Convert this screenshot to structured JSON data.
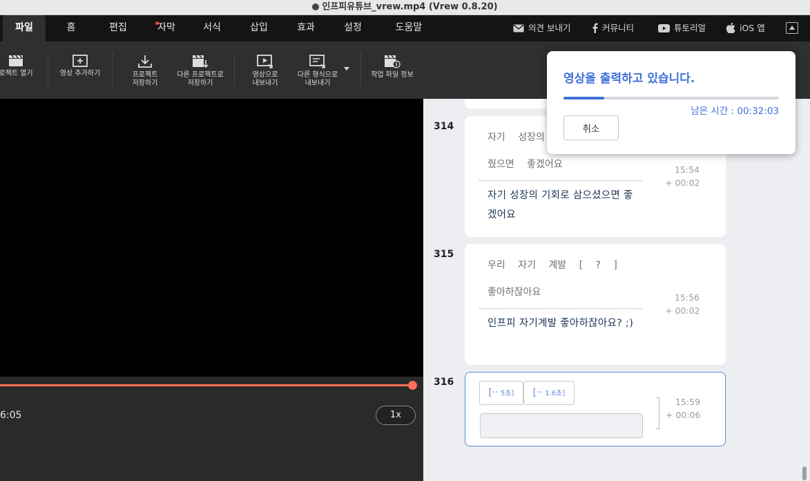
{
  "window": {
    "title": "인프피유튜브_vrew.mp4 (Vrew 0.8.20)"
  },
  "menu": {
    "tabs": [
      {
        "label": "파일"
      },
      {
        "label": "홈"
      },
      {
        "label": "편집"
      },
      {
        "label": "자막"
      },
      {
        "label": "서식"
      },
      {
        "label": "삽입"
      },
      {
        "label": "효과"
      },
      {
        "label": "설정"
      },
      {
        "label": "도움말"
      }
    ],
    "active_tab": "파일",
    "links": {
      "feedback": "의견 보내기",
      "community": "커뮤니티",
      "tutorial": "튜토리얼",
      "ios": "iOS 앱"
    }
  },
  "toolbar": {
    "open_project": "로젝트 열기",
    "add_video": "영상 추가하기",
    "save_project": "프로젝트\n저장하기",
    "save_as": "다른 프로젝트로\n저장하기",
    "export_video": "영상으로\n내보내기",
    "export_other": "다른 형식으로\n내보내기",
    "file_info": "작업 파일 정보"
  },
  "player": {
    "current_time": "6:05",
    "speed": "1x",
    "progress": 1.0
  },
  "clips": [
    {
      "number": "314",
      "words_line1": "자기 성장의",
      "words_line2": "줬으면 좋겠어요",
      "subtitle": "자기 성장의 기회로 삼으셨으면 좋겠어요",
      "time": "15:54",
      "duration": "+ 00:02"
    },
    {
      "number": "315",
      "words_line1": "우리 자기 계발 [ ? ]",
      "words_line2": "좋아하잖아요",
      "subtitle": "인프피 자기계발 좋아하잖아요? ;)",
      "time": "15:56",
      "duration": "+ 00:02"
    },
    {
      "number": "316",
      "silence_chips": [
        {
          "prefix": "[··",
          "value": "5초]"
        },
        {
          "prefix": "[··",
          "value": "1.6초]"
        }
      ],
      "time": "15:59",
      "duration": "+ 00:06"
    }
  ],
  "export_dialog": {
    "title": "영상을 출력하고 있습니다.",
    "progress": 0.19,
    "remaining": "남은 시간 : 00:32:03",
    "cancel_label": "취소"
  },
  "colors": {
    "accent_blue": "#3f6ed7",
    "seek_orange": "#ff6e55",
    "selected_border": "#5a8ad6"
  }
}
